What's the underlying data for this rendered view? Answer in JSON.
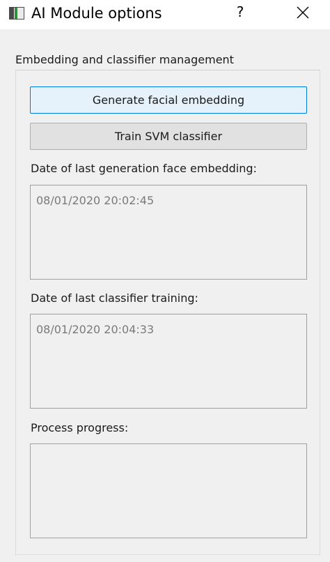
{
  "window": {
    "title": "AI Module options",
    "help_label": "?",
    "icons": {
      "app": "app-window-icon",
      "close": "close-icon"
    }
  },
  "group": {
    "title": "Embedding and classifier management"
  },
  "buttons": {
    "generate_label": "Generate facial embedding",
    "train_label": "Train SVM classifier"
  },
  "fields": {
    "embedding_label": "Date of last generation face embedding:",
    "embedding_value": "08/01/2020 20:02:45",
    "training_label": "Date of last classifier training:",
    "training_value": "08/01/2020 20:04:33",
    "progress_label": "Process progress:",
    "progress_value": ""
  },
  "colors": {
    "focus_border": "#0078d7",
    "background": "#f0f0f0",
    "readonly_text": "#7a7a7a"
  }
}
